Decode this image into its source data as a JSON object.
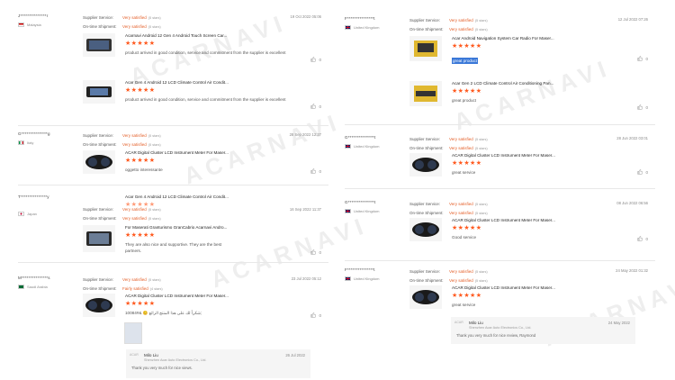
{
  "labels": {
    "service": "Supplier Service:",
    "shipment": "On-time Shipment:"
  },
  "watermark": "ACARNAVI",
  "left": [
    {
      "buyer": "J***************r",
      "country": "Malaysia",
      "flag": "my",
      "service": "Very satisfied",
      "service_count": "(5 stars)",
      "shipment": "Very satisfied",
      "shipment_count": "(5 stars)",
      "date": "19 Oct 2022 05:06",
      "products": [
        {
          "title": "Acarnavi Android 12 Gen 4 Android Touch Screen Car...",
          "stars": "★★★★★",
          "text": "product arrived in good condition, service and commitment from the supplier is excellent",
          "likes": "0"
        },
        {
          "title": "Acar Gen 4 Android 12 LCD Climate Control Air Condit...",
          "stars": "★★★★★",
          "text": "product arrived in good condition, service and commitment from the supplier is excellent",
          "likes": "0"
        }
      ]
    },
    {
      "buyer": "G***************g",
      "country": "Italy",
      "flag": "it",
      "service": "Very satisfied",
      "service_count": "(5 stars)",
      "shipment": "Very satisfied",
      "shipment_count": "(5 stars)",
      "date": "28 Sep 2022 12:27",
      "products": [
        {
          "title": "ACAR Digital Cluster LCD Instrument Meter For Maser...",
          "stars": "★★★★★",
          "text": "oggetto interessante",
          "likes": "0"
        }
      ]
    },
    {
      "buyer": "T***************y",
      "country": "Japan",
      "flag": "jp",
      "service": "Very satisfied",
      "service_count": "(5 stars)",
      "shipment": "Very satisfied",
      "shipment_count": "(5 stars)",
      "date": "16 Sep 2022 11:37",
      "products": [
        {
          "title": "Acar Gen 4 Android 12 LCD Climate Control Air Condit...",
          "stars": "★★★★★",
          "text": "",
          "likes": ""
        },
        {
          "title": "For Maserati Granturismo GranCabrio Acarnavi Andro...",
          "stars": "★★★★★",
          "text": "They are also nice and supportive. They are the best partners.",
          "likes": "0"
        }
      ]
    },
    {
      "buyer": "M***************s",
      "country": "Saudi Arabia",
      "flag": "sa",
      "service": "Very satisfied",
      "service_count": "(5 stars)",
      "shipment": "Fairly satisfied",
      "shipment_count": "(4 stars)",
      "date": "23 Jul 2022 05:12",
      "products": [
        {
          "title": "ACAR Digital Cluster LCD Instrument Meter For Maser...",
          "stars": "★★★★★",
          "text": "شكراً لك على هذا المنتج الرائع 😊 &#10084;",
          "likes": "0"
        }
      ],
      "reply": {
        "seller": "Milo Liu",
        "company": "Shenzhen Acar Auto Electronics Co., Ltd.",
        "date": "26 Jul 2022",
        "text": "Thank you very much for nice views."
      }
    }
  ],
  "right": [
    {
      "buyer": "F***************t",
      "country": "United Kingdom",
      "flag": "gb",
      "service": "Very satisfied",
      "service_count": "(5 stars)",
      "shipment": "Very satisfied",
      "shipment_count": "(5 stars)",
      "date": "12 Jul 2022 07:26",
      "products": [
        {
          "title": "Acar Android Navigation System Car Radio For Maser...",
          "stars": "★★★★★",
          "text": "great product",
          "likes": "0"
        },
        {
          "title": "Acar Gen 2 LCD Climate Control Air Conditioning Pan...",
          "stars": "★★★★★",
          "text": "great product",
          "likes": "0"
        }
      ]
    },
    {
      "buyer": "G***************t",
      "country": "United Kingdom",
      "flag": "gb",
      "service": "Very satisfied",
      "service_count": "(5 stars)",
      "shipment": "Very satisfied",
      "shipment_count": "(5 stars)",
      "date": "28 Jun 2022 03:01",
      "products": [
        {
          "title": "ACAR Digital Cluster LCD Instrument Meter For Maser...",
          "stars": "★★★★★",
          "text": "great service",
          "likes": "0"
        }
      ]
    },
    {
      "buyer": "G***************t",
      "country": "United Kingdom",
      "flag": "gb",
      "service": "Very satisfied",
      "service_count": "(5 stars)",
      "shipment": "Very satisfied",
      "shipment_count": "(5 stars)",
      "date": "08 Jun 2022 06:56",
      "products": [
        {
          "title": "ACAR Digital Cluster LCD Instrument Meter For Maser...",
          "stars": "★★★★★",
          "text": "Good service",
          "likes": "0"
        }
      ]
    },
    {
      "buyer": "F***************t",
      "country": "United Kingdom",
      "flag": "gb",
      "service": "Very satisfied",
      "service_count": "(5 stars)",
      "shipment": "Very satisfied",
      "shipment_count": "(5 stars)",
      "date": "24 May 2022 01:32",
      "products": [
        {
          "title": "ACAR Digital Cluster LCD Instrument Meter For Maser...",
          "stars": "★★★★★",
          "text": "great service",
          "likes": ""
        }
      ],
      "reply": {
        "seller": "Milo Liu",
        "company": "Shenzhen Acar Auto Electronics Co., Ltd.",
        "date": "24 May 2022",
        "text": "Thank you very much for nice review, Raymond"
      }
    }
  ]
}
